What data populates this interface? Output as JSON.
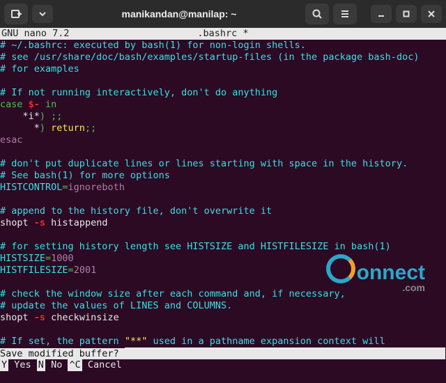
{
  "window": {
    "title": "manikandan@manilap: ~"
  },
  "editor": {
    "app": "GNU nano 7.2",
    "filename": ".bashrc",
    "modified_marker": "*"
  },
  "code": {
    "l1": "# ~/.bashrc: executed by bash(1) for non-login shells.",
    "l2": "# see /usr/share/doc/bash/examples/startup-files (in the package bash-doc)",
    "l3": "# for examples",
    "l5": "# If not running interactively, don't do anything",
    "l6a": "case ",
    "l6b": "$-",
    "l6c": " in",
    "l7a": "    *i*",
    "l7b": ") ;;",
    "l8a": "      *",
    "l8b": ") ",
    "l8c": "return",
    "l8d": ";;",
    "l9": "esac",
    "l11": "# don't put duplicate lines or lines starting with space in the history.",
    "l12": "# See bash(1) for more options",
    "l13a": "HISTCONTROL",
    "l13b": "=",
    "l13c": "ignoreboth",
    "l15": "# append to the history file, don't overwrite it",
    "l16a": "shopt ",
    "l16b": "-s",
    "l16c": " histappend",
    "l18": "# for setting history length see HISTSIZE and HISTFILESIZE in bash(1)",
    "l19a": "HISTSIZE",
    "l19b": "=",
    "l19c": "1000",
    "l20a": "HISTFILESIZE",
    "l20b": "=",
    "l20c": "2001",
    "l22": "# check the window size after each command and, if necessary,",
    "l23": "# update the values of LINES and COLUMNS.",
    "l24a": "shopt ",
    "l24b": "-s",
    "l24c": " checkwinsize",
    "l26a": "# If set, the pattern ",
    "l26b": "\"**\"",
    "l26c": " used in a pathname expansion context will"
  },
  "prompt": {
    "question": "Save modified buffer? ",
    "yes_key": " Y",
    "yes_label": " Yes",
    "no_key": " N",
    "no_label": " No",
    "cancel_key": "^C",
    "cancel_label": " Cancel"
  },
  "watermark": {
    "brand": "onnect",
    "domain": ".com"
  }
}
